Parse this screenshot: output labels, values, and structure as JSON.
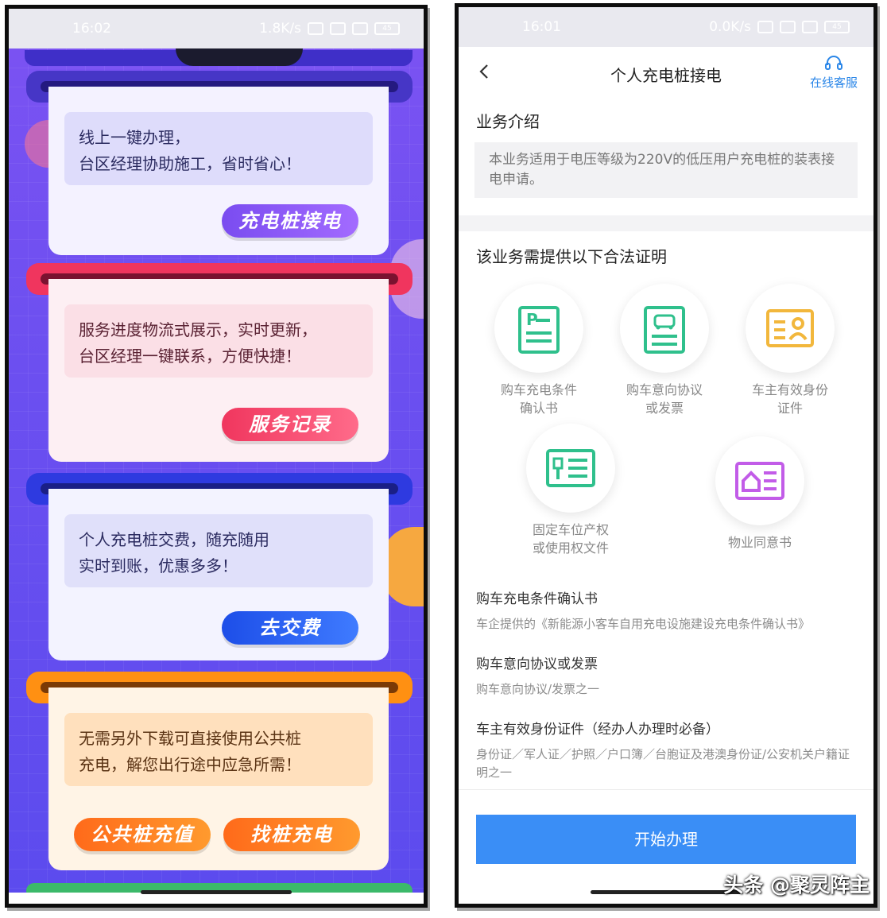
{
  "left_phone": {
    "status": {
      "time": "16:02",
      "speed": "1.8K/s",
      "battery": "45"
    },
    "cards": [
      {
        "lines": [
          "线上一键办理，",
          "台区经理协助施工，省时省心！"
        ],
        "buttons": [
          "充电桩接电"
        ]
      },
      {
        "lines": [
          "服务进度物流式展示，实时更新，",
          "台区经理一键联系，方便快捷！"
        ],
        "buttons": [
          "服务记录"
        ]
      },
      {
        "lines": [
          "个人充电桩交费，随充随用",
          "实时到账，优惠多多！"
        ],
        "buttons": [
          "去交费"
        ]
      },
      {
        "lines": [
          "无需另外下载可直接使用公共桩",
          "充电，解您出行途中应急所需！"
        ],
        "buttons": [
          "公共桩充值",
          "找桩充电"
        ]
      }
    ]
  },
  "right_phone": {
    "status": {
      "time": "16:01",
      "speed": "0.0K/s",
      "battery": "45"
    },
    "nav": {
      "title": "个人充电桩接电",
      "customer_service": "在线客服"
    },
    "intro": {
      "title": "业务介绍",
      "text": "本业务适用于电压等级为220V的低压用户充电桩的装表接电申请。"
    },
    "docs_title": "该业务需提供以下合法证明",
    "docs": [
      {
        "label_lines": [
          "购车充电条件",
          "确认书"
        ],
        "icon": "document-p-icon",
        "color": "#2fc08c"
      },
      {
        "label_lines": [
          "购车意向协议",
          "或发票"
        ],
        "icon": "car-document-icon",
        "color": "#2fc08c"
      },
      {
        "label_lines": [
          "车主有效身份",
          "证件"
        ],
        "icon": "id-card-icon",
        "color": "#f2b73c"
      },
      {
        "label_lines": [
          "固定车位产权",
          "或使用权文件"
        ],
        "icon": "parking-certificate-icon",
        "color": "#2fc08c"
      },
      {
        "label_lines": [
          "物业同意书"
        ],
        "icon": "property-consent-icon",
        "color": "#c25ce8"
      }
    ],
    "requirements": [
      {
        "name": "购车充电条件确认书",
        "desc": "车企提供的《新能源小客车自用充电设施建设充电条件确认书》"
      },
      {
        "name": "购车意向协议或发票",
        "desc": "购车意向协议/发票之一"
      },
      {
        "name": "车主有效身份证件（经办人办理时必备）",
        "desc": "身份证／军人证／护照／户口簿／台胞证及港澳身份证/公安机关户籍证明之一"
      }
    ],
    "start_button": "开始办理",
    "watermark": "头条 @聚灵阵主"
  }
}
